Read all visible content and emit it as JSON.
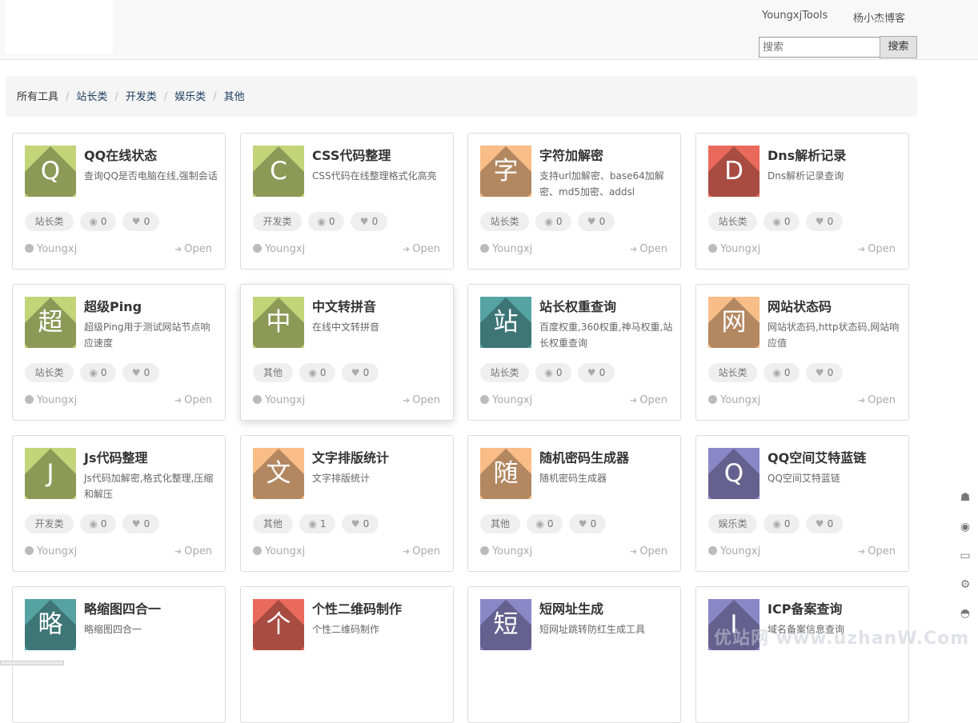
{
  "nav": {
    "link1": "YoungxjTools",
    "link2": "杨小杰博客"
  },
  "search": {
    "placeholder": "搜索",
    "button": "搜索"
  },
  "breadcrumb": {
    "all": "所有工具",
    "c1": "站长类",
    "c2": "开发类",
    "c3": "娱乐类",
    "c4": "其他"
  },
  "colors": {
    "green": "#c3d479",
    "orange": "#f9bd87",
    "red": "#e9695b",
    "teal": "#56a3a4",
    "purple": "#8b87c7"
  },
  "cards": [
    {
      "tile": "Q",
      "tile_color": "green",
      "title": "QQ在线状态",
      "desc": "查询QQ是否电脑在线,强制会话",
      "tag": "站长类",
      "views": "0",
      "likes": "0",
      "author": "Youngxj",
      "open": "Open"
    },
    {
      "tile": "C",
      "tile_color": "green",
      "title": "CSS代码整理",
      "desc": "CSS代码在线整理格式化高亮",
      "tag": "开发类",
      "views": "0",
      "likes": "0",
      "author": "Youngxj",
      "open": "Open"
    },
    {
      "tile": "字",
      "tile_color": "orange",
      "title": "字符加解密",
      "desc": "支持url加解密、base64加解密、md5加密、addsl",
      "tag": "站长类",
      "views": "0",
      "likes": "0",
      "author": "Youngxj",
      "open": "Open"
    },
    {
      "tile": "D",
      "tile_color": "red",
      "title": "Dns解析记录",
      "desc": "Dns解析记录查询",
      "tag": "站长类",
      "views": "0",
      "likes": "0",
      "author": "Youngxj",
      "open": "Open"
    },
    {
      "tile": "超",
      "tile_color": "green",
      "title": "超级Ping",
      "desc": "超级Ping用于测试网站节点响应速度",
      "tag": "站长类",
      "views": "0",
      "likes": "0",
      "author": "Youngxj",
      "open": "Open"
    },
    {
      "tile": "中",
      "tile_color": "green",
      "title": "中文转拼音",
      "desc": "在线中文转拼音",
      "tag": "其他",
      "views": "0",
      "likes": "0",
      "author": "Youngxj",
      "open": "Open"
    },
    {
      "tile": "站",
      "tile_color": "teal",
      "title": "站长权重查询",
      "desc": "百度权重,360权重,神马权重,站长权重查询",
      "tag": "站长类",
      "views": "0",
      "likes": "0",
      "author": "Youngxj",
      "open": "Open"
    },
    {
      "tile": "网",
      "tile_color": "orange",
      "title": "网站状态码",
      "desc": "网站状态码,http状态码,网站响应值",
      "tag": "站长类",
      "views": "0",
      "likes": "0",
      "author": "Youngxj",
      "open": "Open"
    },
    {
      "tile": "J",
      "tile_color": "green",
      "title": "Js代码整理",
      "desc": "Js代码加解密,格式化整理,压缩和解压",
      "tag": "开发类",
      "views": "0",
      "likes": "0",
      "author": "Youngxj",
      "open": "Open"
    },
    {
      "tile": "文",
      "tile_color": "orange",
      "title": "文字排版统计",
      "desc": "文字排版统计",
      "tag": "其他",
      "views": "1",
      "likes": "0",
      "author": "Youngxj",
      "open": "Open"
    },
    {
      "tile": "随",
      "tile_color": "orange",
      "title": "随机密码生成器",
      "desc": "随机密码生成器",
      "tag": "其他",
      "views": "0",
      "likes": "0",
      "author": "Youngxj",
      "open": "Open"
    },
    {
      "tile": "Q",
      "tile_color": "purple",
      "title": "QQ空间艾特蓝链",
      "desc": "QQ空间艾特蓝链",
      "tag": "娱乐类",
      "views": "0",
      "likes": "0",
      "author": "Youngxj",
      "open": "Open"
    },
    {
      "tile": "略",
      "tile_color": "teal",
      "title": "略缩图四合一",
      "desc": "略缩图四合一",
      "tag": "",
      "views": "",
      "likes": "",
      "author": "",
      "open": ""
    },
    {
      "tile": "个",
      "tile_color": "red",
      "title": "个性二维码制作",
      "desc": "个性二维码制作",
      "tag": "",
      "views": "",
      "likes": "",
      "author": "",
      "open": ""
    },
    {
      "tile": "短",
      "tile_color": "purple",
      "title": "短网址生成",
      "desc": "短网址跳转防红生成工具",
      "tag": "",
      "views": "",
      "likes": "",
      "author": "",
      "open": ""
    },
    {
      "tile": "I",
      "tile_color": "purple",
      "title": "ICP备案查询",
      "desc": "域名备案信息查询",
      "tag": "",
      "views": "",
      "likes": "",
      "author": "",
      "open": ""
    }
  ],
  "side_icons": [
    "qq-icon",
    "weibo-icon",
    "monitor-icon",
    "gear-icon",
    "github-icon"
  ],
  "watermark": "优站网 www.uzhanW.Com"
}
